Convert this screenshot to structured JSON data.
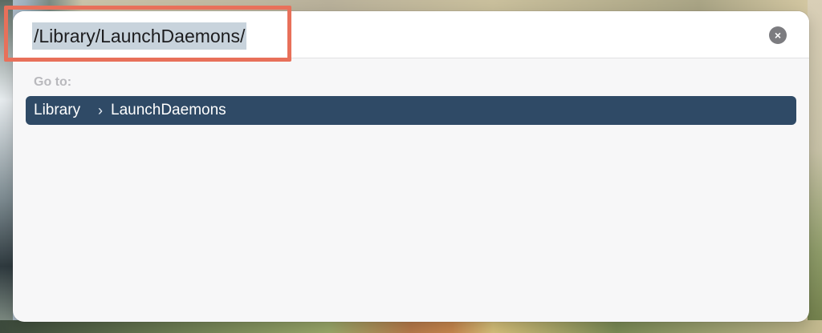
{
  "dialog": {
    "path_value": "/Library/LaunchDaemons/",
    "clear_icon": "×",
    "goto_label": "Go to:",
    "results": [
      {
        "segments": [
          "Library",
          "LaunchDaemons"
        ],
        "separator": "›"
      }
    ]
  },
  "colors": {
    "selection_row": "#2f4a66",
    "highlight_annotation": "#e8705a",
    "text_selection": "#c8d3dc"
  }
}
